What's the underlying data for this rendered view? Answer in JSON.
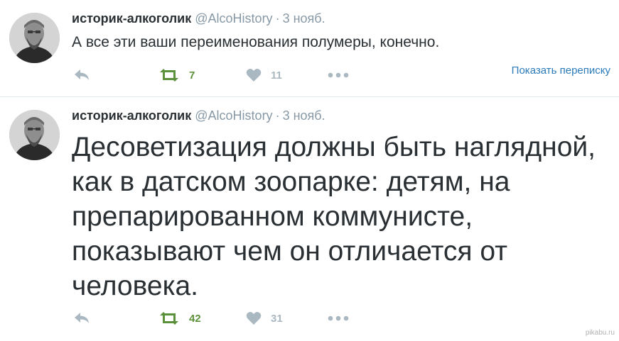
{
  "tweets": [
    {
      "fullname": "историк-алкоголик",
      "handle": "@AlcoHistory",
      "separator": "·",
      "time": "3 нояб.",
      "text": "А все эти ваши переименования полумеры, конечно.",
      "retweets": "7",
      "likes": "11",
      "show_conversation": "Показать переписку"
    },
    {
      "fullname": "историк-алкоголик",
      "handle": "@AlcoHistory",
      "separator": "·",
      "time": "3 нояб.",
      "text_lines": [
        "Десоветизация должны быть наглядной,",
        "как в датском зоопарке: детям, на",
        "препарированном коммунисте,",
        "показывают чем он отличается от",
        "человека."
      ],
      "retweets": "42",
      "likes": "31"
    }
  ],
  "icons": {
    "reply": "reply-icon",
    "retweet": "retweet-icon",
    "like": "heart-icon",
    "more": "more-icon",
    "avatar": "avatar-portrait"
  },
  "colors": {
    "name": "#292f33",
    "meta": "#8899a6",
    "retweet_active": "#5c913b",
    "icon_gray": "#aab8c2",
    "link": "#2b7bb9",
    "divider": "#e1e8ed"
  },
  "watermark": "pikabu.ru"
}
